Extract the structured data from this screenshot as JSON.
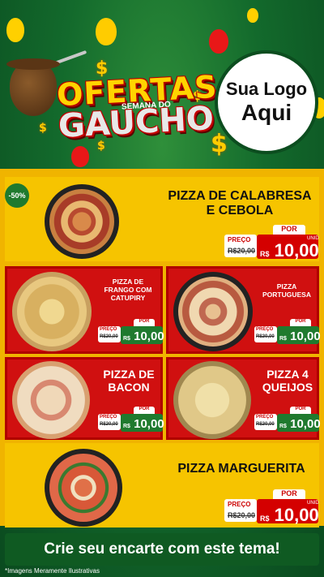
{
  "header": {
    "title_line1": "OFERTAS",
    "title_sub": "SEMANA DO",
    "title_line2": "GAUCHO",
    "logo_line1": "Sua Logo",
    "logo_line2": "Aqui"
  },
  "discount_badge": "-50%",
  "products": [
    {
      "name_line1": "PIZZA DE CALABRESA",
      "name_line2": "E CEBOLA",
      "por": "POR",
      "preco": "PREÇO",
      "de": "R$20,00",
      "rs": "R$",
      "price": "10,00",
      "unid": "UNID"
    },
    {
      "name_line1": "PIZZA DE",
      "name_line2": "FRANGO COM",
      "name_line3": "CATUPIRY",
      "por": "POR",
      "preco": "PREÇO",
      "de": "R$20,00",
      "rs": "R$",
      "price": "10,00",
      "unid": "UNID"
    },
    {
      "name_line1": "PIZZA",
      "name_line2": "PORTUGUESA",
      "por": "POR",
      "preco": "PREÇO",
      "de": "R$20,00",
      "rs": "R$",
      "price": "10,00",
      "unid": "UNID"
    },
    {
      "name_line1": "PIZZA DE",
      "name_line2": "BACON",
      "por": "POR",
      "preco": "PREÇO",
      "de": "R$20,00",
      "rs": "R$",
      "price": "10,00",
      "unid": "UNID"
    },
    {
      "name_line1": "PIZZA 4",
      "name_line2": "QUEIJOS",
      "por": "POR",
      "preco": "PREÇO",
      "de": "R$20,00",
      "rs": "R$",
      "price": "10,00",
      "unid": "UNID"
    },
    {
      "name_line1": "PIZZA MARGUERITA",
      "por": "POR",
      "preco": "PREÇO",
      "de": "R$20,00",
      "rs": "R$",
      "price": "10,00",
      "unid": "UNID"
    }
  ],
  "cta": "Crie seu encarte com este tema!",
  "disclaimer": "*Imagens Meramente Ilustrativas",
  "colors": {
    "green": "#0f5a22",
    "red": "#d01010",
    "yellow": "#f6c400"
  }
}
